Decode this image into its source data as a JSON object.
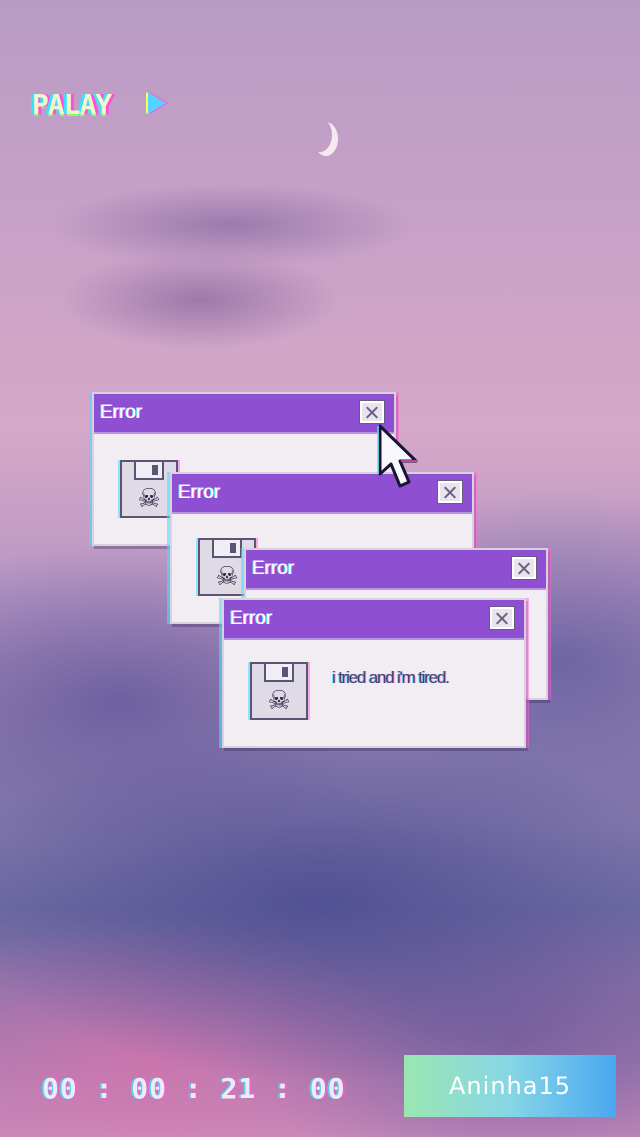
{
  "overlay": {
    "vhs_label": "PALAY",
    "play_icon": "play-arrow-icon",
    "timecode": "00 : 00 : 21 : 00",
    "watermark": "Aninha15"
  },
  "dialogs": [
    {
      "title": "Error",
      "icon": "floppy-skull-icon",
      "close_icon": "close-icon"
    },
    {
      "title": "Error",
      "icon": "floppy-skull-icon",
      "close_icon": "close-icon"
    },
    {
      "title": "Error",
      "icon": "floppy-skull-icon",
      "close_icon": "close-icon"
    },
    {
      "title": "Error",
      "icon": "floppy-skull-icon",
      "close_icon": "close-icon",
      "message": "i tried and i'm tired."
    }
  ],
  "colors": {
    "titlebar": "#8e4fd2",
    "dialog_body": "#f1edf2",
    "watermark_start": "#9be6b2",
    "watermark_end": "#4aa8f0"
  }
}
